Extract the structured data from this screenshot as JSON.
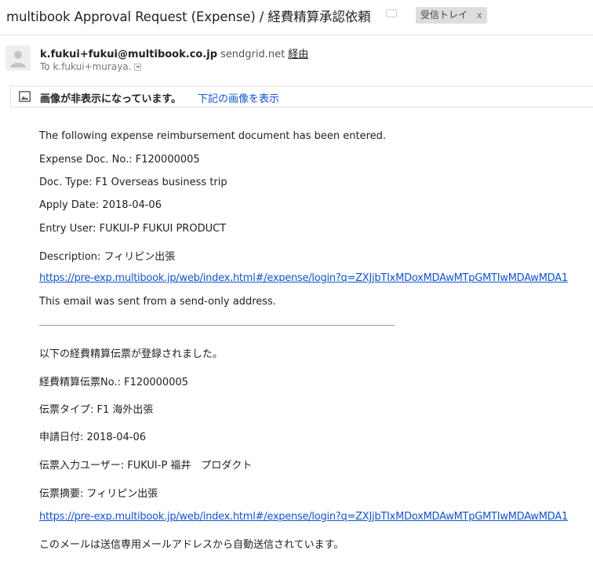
{
  "subject": "multibook Approval Request (Expense) / 経費精算承認依頼",
  "label": {
    "text": "受信トレイ",
    "remove": "x"
  },
  "sender": {
    "email": "k.fukui+fukui@multibook.co.jp",
    "via": "sendgrid.net",
    "via_link": "経由",
    "to": "To k.fukui+muraya."
  },
  "images_bar": {
    "message": "画像が非表示になっています。",
    "link": "下記の画像を表示"
  },
  "body_en": {
    "intro": "The following expense reimbursement document has been entered.",
    "doc_no": "Expense Doc. No.: F120000005",
    "doc_type": "Doc. Type: F1 Overseas business trip",
    "apply_date": "Apply Date: 2018-04-06",
    "entry_user": "Entry User: FUKUI-P FUKUI PRODUCT",
    "description": "Description: フィリピン出張",
    "link": "https://pre-exp.multibook.jp/web/index.html#/expense/login?q=ZXJjbTIxMDoxMDAwMTpGMTIwMDAwMDA1",
    "footer": "This email was sent from a send-only address."
  },
  "body_ja": {
    "intro": "以下の経費精算伝票が登録されました。",
    "doc_no": "経費精算伝票No.: F120000005",
    "doc_type": "伝票タイプ: F1 海外出張",
    "apply_date": "申請日付: 2018-04-06",
    "entry_user": "伝票入力ユーザー: FUKUI-P 福井　プロダクト",
    "description": "伝票摘要: フィリピン出張",
    "link": "https://pre-exp.multibook.jp/web/index.html#/expense/login?q=ZXJjbTIxMDoxMDAwMTpGMTIwMDAwMDA1",
    "footer": "このメールは送信専用メールアドレスから自動送信されています。"
  },
  "icons": {
    "important": "important-marker-icon",
    "avatar": "default-avatar-icon",
    "image": "image-placeholder-icon",
    "dropdown": "chevron-down-icon"
  },
  "colors": {
    "link": "#1155cc",
    "chip_bg": "#dddddd",
    "text": "#222222"
  }
}
